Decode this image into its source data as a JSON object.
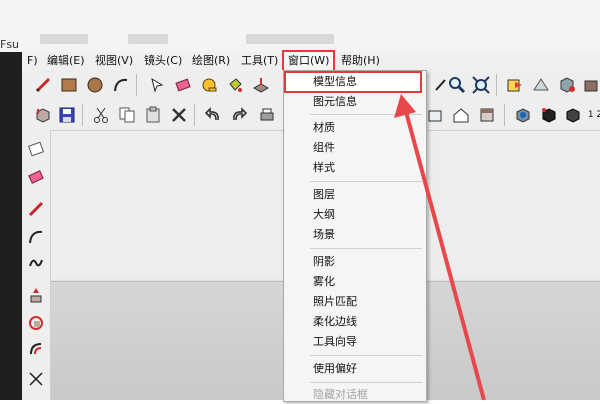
{
  "title": {
    "fragment": "Fsu"
  },
  "menubar": {
    "items": [
      {
        "label": "F)",
        "id": "file"
      },
      {
        "label": "编辑(E)",
        "id": "edit"
      },
      {
        "label": "视图(V)",
        "id": "view"
      },
      {
        "label": "镜头(C)",
        "id": "camera"
      },
      {
        "label": "绘图(R)",
        "id": "draw"
      },
      {
        "label": "工具(T)",
        "id": "tools"
      },
      {
        "label": "窗口(W)",
        "id": "window"
      },
      {
        "label": "帮助(H)",
        "id": "help"
      }
    ]
  },
  "window_menu": {
    "items": [
      {
        "label": "模型信息",
        "disabled": false
      },
      {
        "label": "图元信息",
        "disabled": false
      },
      {
        "label": "材质",
        "disabled": false
      },
      {
        "label": "组件",
        "disabled": false
      },
      {
        "label": "样式",
        "disabled": false
      },
      {
        "label": "图层",
        "disabled": false
      },
      {
        "label": "大纲",
        "disabled": false
      },
      {
        "label": "场景",
        "disabled": false
      },
      {
        "label": "阴影",
        "disabled": false
      },
      {
        "label": "雾化",
        "disabled": false
      },
      {
        "label": "照片匹配",
        "disabled": false
      },
      {
        "label": "柔化边线",
        "disabled": false
      },
      {
        "label": "工具向导",
        "disabled": false
      },
      {
        "label": "使用偏好",
        "disabled": false
      },
      {
        "label": "隐藏对话框",
        "disabled": true
      }
    ]
  },
  "toolbar2": {
    "label_12": "1 2"
  },
  "colors": {
    "highlight": "#e33b3b",
    "arrow": "#e8474b"
  },
  "icons": {
    "pencil": "pencil-icon",
    "rectangle": "rectangle-icon",
    "circle": "circle-icon",
    "arc": "arc-icon",
    "eraser": "eraser-icon",
    "tape": "tape-measure-icon",
    "paint": "paint-bucket-icon",
    "zoom": "zoom-icon",
    "zoom_extents": "zoom-extents-icon",
    "save": "save-icon",
    "cut": "cut-icon",
    "undo": "undo-icon",
    "redo": "redo-icon",
    "house": "house-icon"
  }
}
